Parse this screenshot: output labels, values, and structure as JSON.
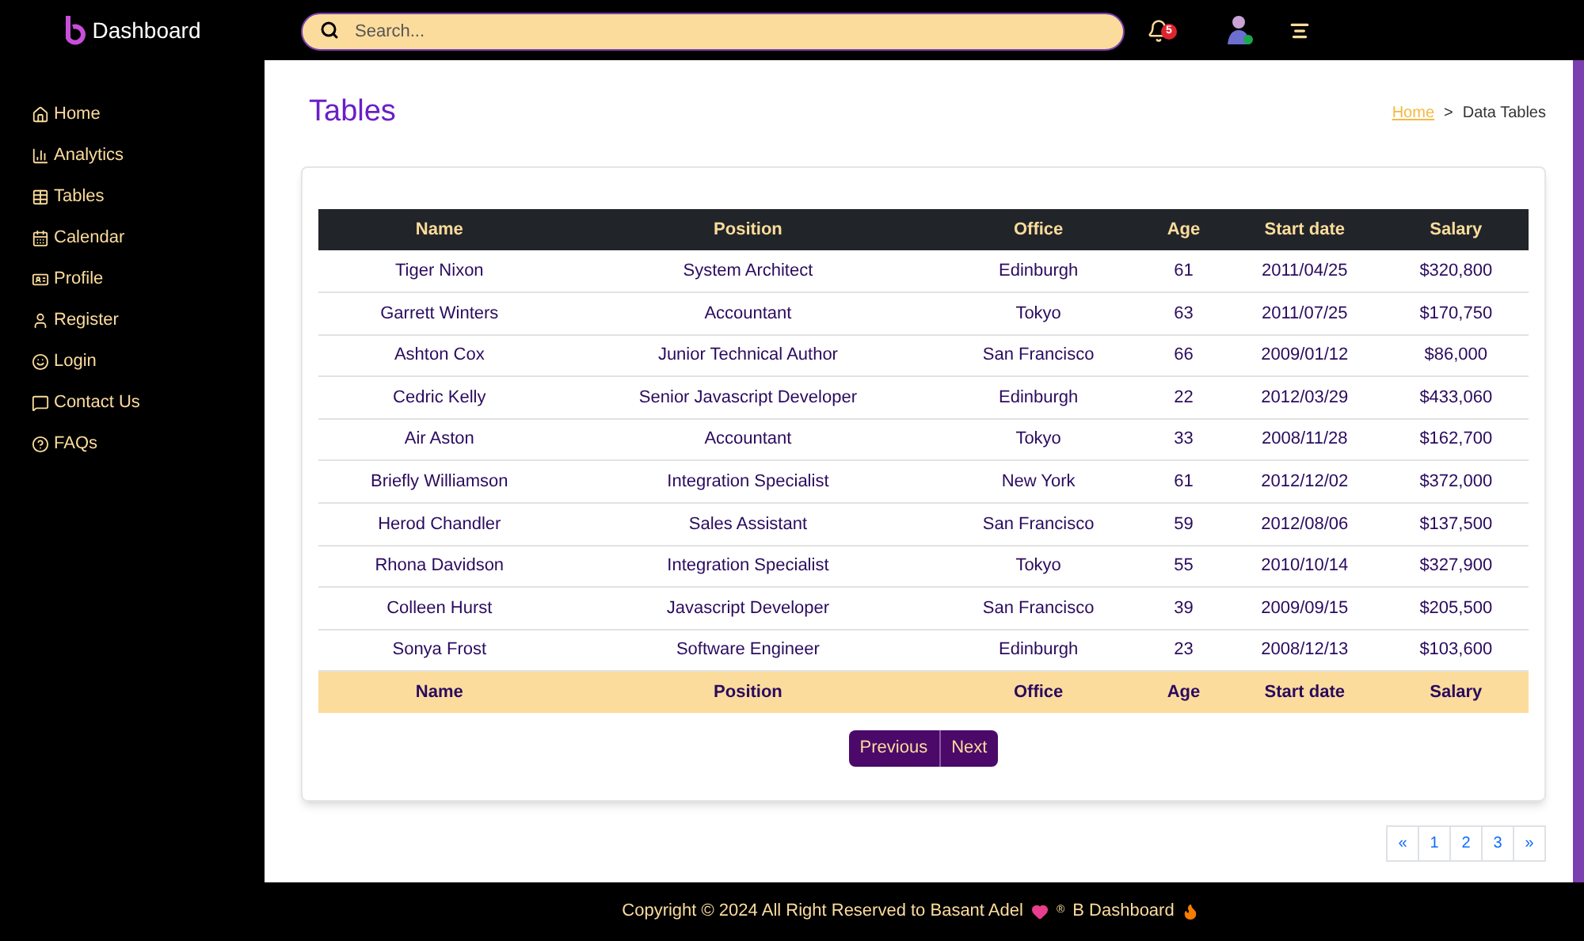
{
  "brand": {
    "name": "Dashboard"
  },
  "search": {
    "placeholder": "Search..."
  },
  "notifications": {
    "count": "5"
  },
  "sidebar": {
    "items": [
      {
        "label": "Home",
        "kind": "home"
      },
      {
        "label": "Analytics",
        "kind": "analytics"
      },
      {
        "label": "Tables",
        "kind": "tables"
      },
      {
        "label": "Calendar",
        "kind": "calendar"
      },
      {
        "label": "Profile",
        "kind": "profile"
      },
      {
        "label": "Register",
        "kind": "register"
      },
      {
        "label": "Login",
        "kind": "login"
      },
      {
        "label": "Contact Us",
        "kind": "contact"
      },
      {
        "label": "FAQs",
        "kind": "faqs"
      }
    ]
  },
  "page": {
    "title": "Tables",
    "breadcrumb": {
      "link": "Home",
      "separator": ">",
      "current": "Data Tables"
    }
  },
  "table": {
    "columns": [
      "Name",
      "Position",
      "Office",
      "Age",
      "Start date",
      "Salary"
    ],
    "rows": [
      [
        "Tiger Nixon",
        "System Architect",
        "Edinburgh",
        "61",
        "2011/04/25",
        "$320,800"
      ],
      [
        "Garrett Winters",
        "Accountant",
        "Tokyo",
        "63",
        "2011/07/25",
        "$170,750"
      ],
      [
        "Ashton Cox",
        "Junior Technical Author",
        "San Francisco",
        "66",
        "2009/01/12",
        "$86,000"
      ],
      [
        "Cedric Kelly",
        "Senior Javascript Developer",
        "Edinburgh",
        "22",
        "2012/03/29",
        "$433,060"
      ],
      [
        "Air Aston",
        "Accountant",
        "Tokyo",
        "33",
        "2008/11/28",
        "$162,700"
      ],
      [
        "Briefly Williamson",
        "Integration Specialist",
        "New York",
        "61",
        "2012/12/02",
        "$372,000"
      ],
      [
        "Herod Chandler",
        "Sales Assistant",
        "San Francisco",
        "59",
        "2012/08/06",
        "$137,500"
      ],
      [
        "Rhona Davidson",
        "Integration Specialist",
        "Tokyo",
        "55",
        "2010/10/14",
        "$327,900"
      ],
      [
        "Colleen Hurst",
        "Javascript Developer",
        "San Francisco",
        "39",
        "2009/09/15",
        "$205,500"
      ],
      [
        "Sonya Frost",
        "Software Engineer",
        "Edinburgh",
        "23",
        "2008/12/13",
        "$103,600"
      ]
    ],
    "footer": [
      "Name",
      "Position",
      "Office",
      "Age",
      "Start date",
      "Salary"
    ]
  },
  "table_pager": [
    "Previous",
    "Next"
  ],
  "pagination": [
    "«",
    "1",
    "2",
    "3",
    "»"
  ],
  "footer": {
    "text": "Copyright © 2024 All Right Reserved to Basant Adel",
    "mark": "®",
    "brand": "B Dashboard"
  }
}
